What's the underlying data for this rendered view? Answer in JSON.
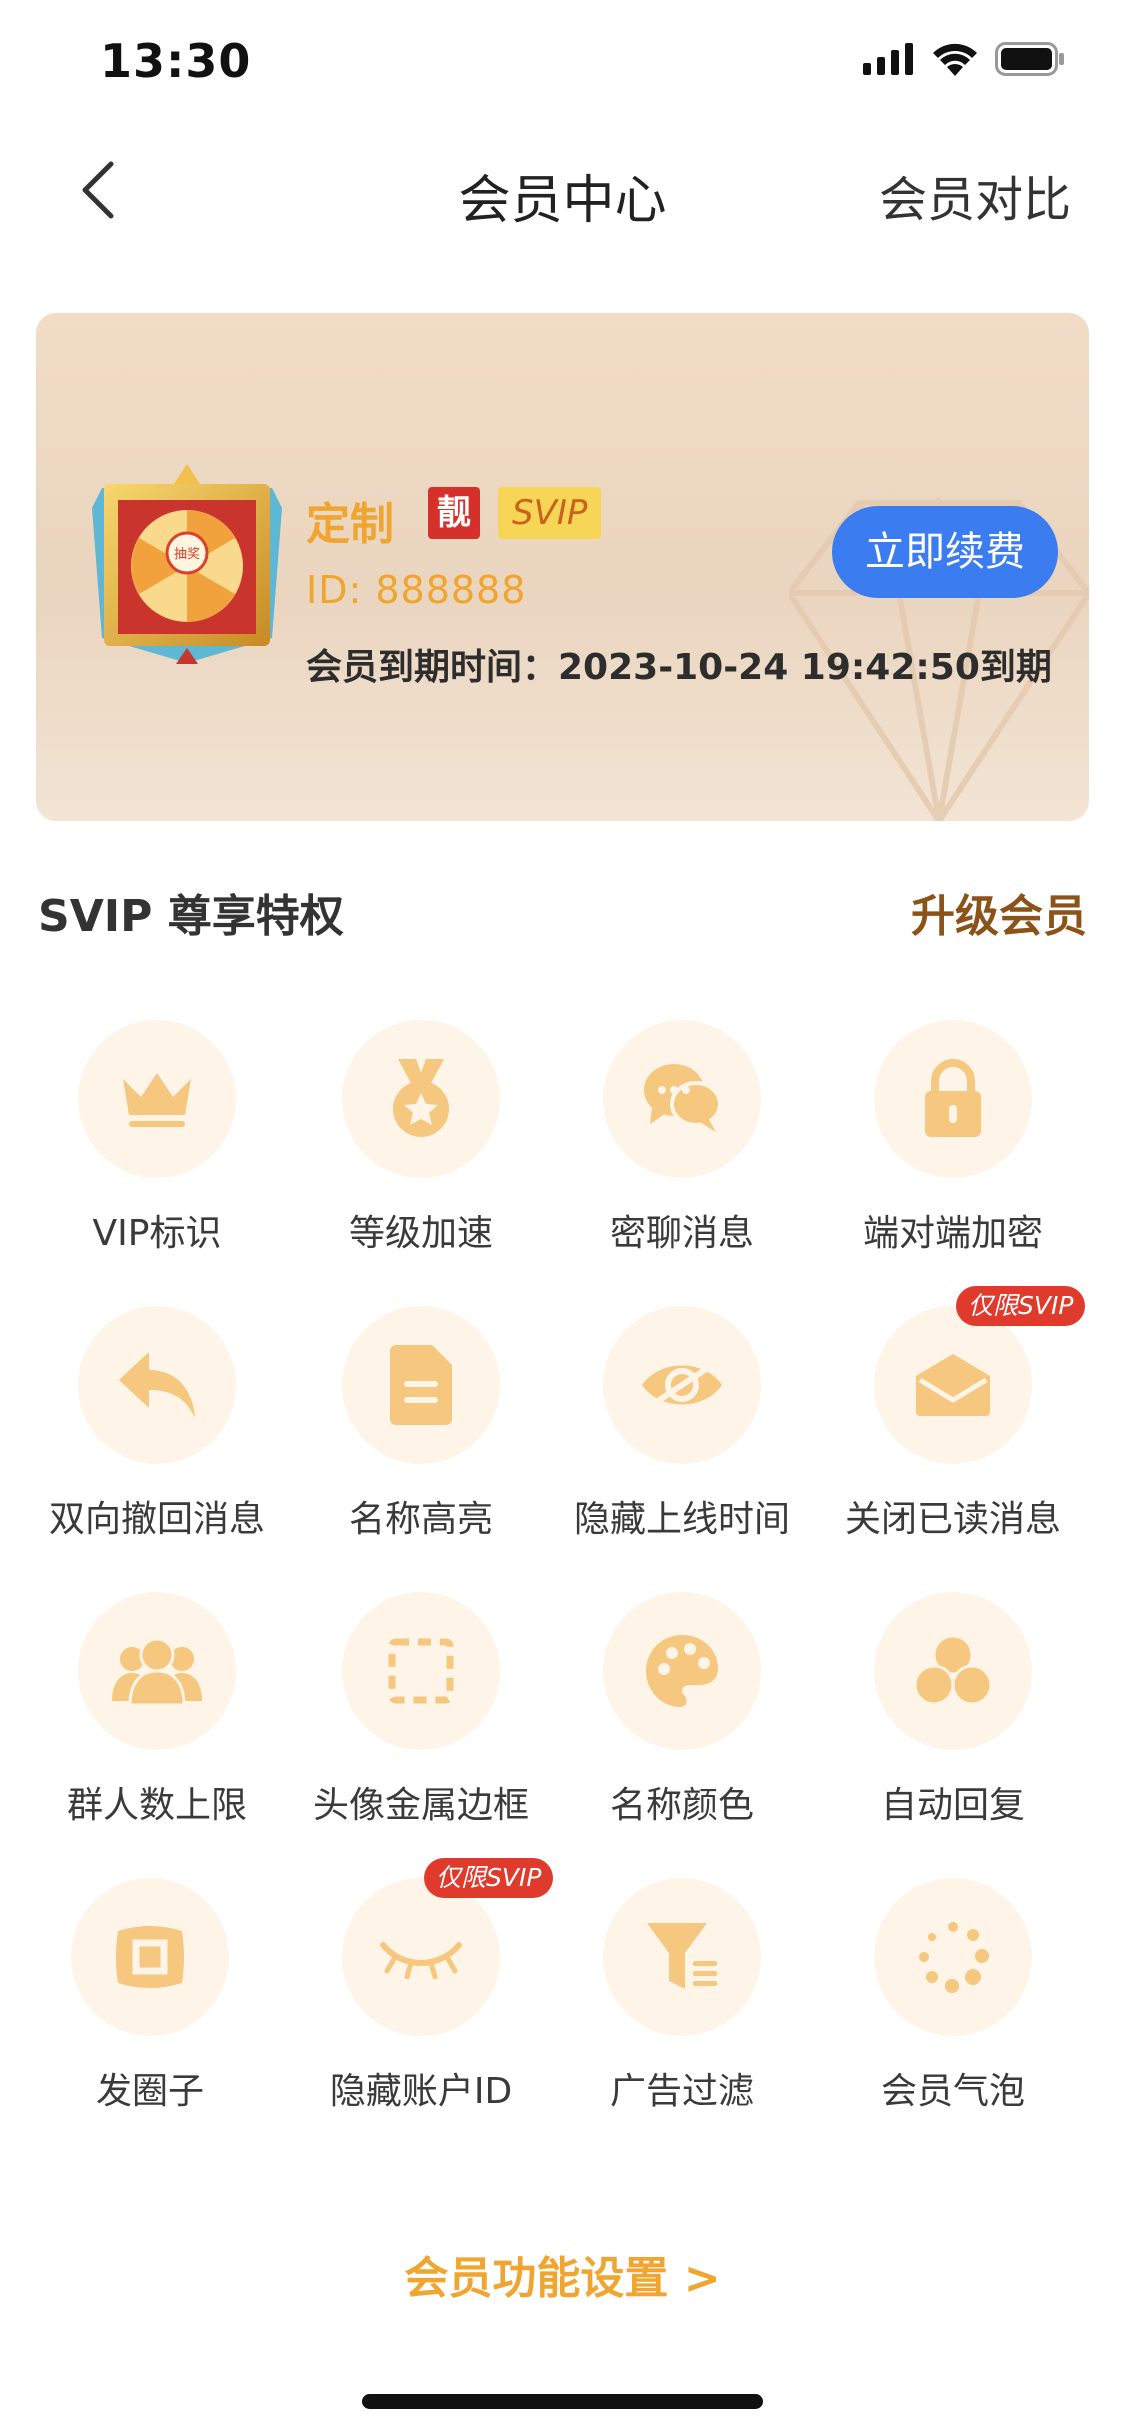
{
  "status_bar": {
    "time": "13:30"
  },
  "nav": {
    "title": "会员中心",
    "compare": "会员对比"
  },
  "card": {
    "name": "定制",
    "badge_liang": "靓",
    "badge_svip": "SVIP",
    "id_text": "ID: 888888",
    "expiry_text": "会员到期时间：2023-10-24 19:42:50到期",
    "renew_button": "立即续费",
    "avatar_text": "抽奖"
  },
  "section": {
    "title_prefix": "SVIP",
    "title_rest": "尊享特权",
    "upgrade": "升级会员"
  },
  "features": [
    {
      "label": "VIP标识",
      "icon": "crown-icon"
    },
    {
      "label": "等级加速",
      "icon": "medal-icon"
    },
    {
      "label": "密聊消息",
      "icon": "chat-bubbles-icon"
    },
    {
      "label": "端对端加密",
      "icon": "lock-icon"
    },
    {
      "label": "双向撤回消息",
      "icon": "reply-arrow-icon"
    },
    {
      "label": "名称高亮",
      "icon": "document-icon"
    },
    {
      "label": "隐藏上线时间",
      "icon": "eye-slash-icon"
    },
    {
      "label": "关闭已读消息",
      "icon": "envelope-icon",
      "tag": "仅限SVIP"
    },
    {
      "label": "群人数上限",
      "icon": "group-icon"
    },
    {
      "label": "头像金属边框",
      "icon": "dashed-frame-icon"
    },
    {
      "label": "名称颜色",
      "icon": "palette-icon"
    },
    {
      "label": "自动回复",
      "icon": "three-circles-icon"
    },
    {
      "label": "发圈子",
      "icon": "square-frame-icon"
    },
    {
      "label": "隐藏账户ID",
      "icon": "closed-eye-icon",
      "tag": "仅限SVIP"
    },
    {
      "label": "广告过滤",
      "icon": "filter-icon"
    },
    {
      "label": "会员气泡",
      "icon": "dots-loader-icon"
    }
  ],
  "settings_link": "会员功能设置 >",
  "colors": {
    "accent_gold": "#f0a530",
    "icon_gold": "#f6c77e",
    "renew_blue": "#3b7cf1",
    "tag_red": "#e03a2c",
    "upgrade_brown": "#8b5318"
  }
}
